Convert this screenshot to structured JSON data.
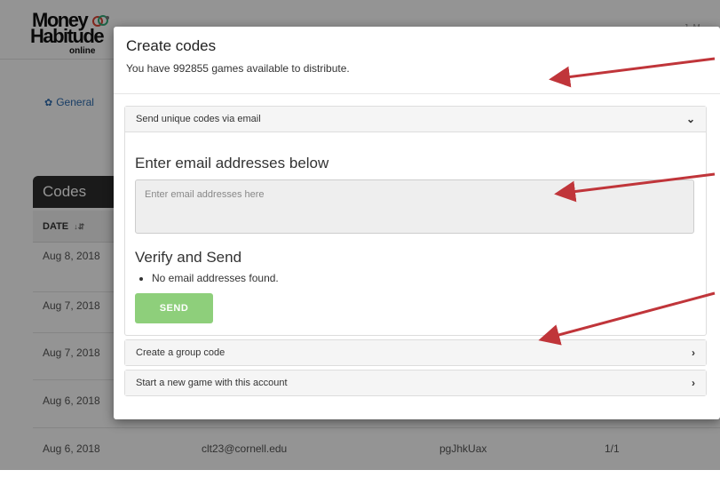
{
  "header": {
    "logo_line1": "Money",
    "logo_line2": "Habitude",
    "logo_sub": "online",
    "user_initials": "J. M"
  },
  "nav": {
    "general_label": "General",
    "general_icon": "gear-icon"
  },
  "codes_table": {
    "title": "Codes",
    "date_header": "DATE",
    "rows": [
      {
        "date": "Aug 8, 2018",
        "email": "",
        "code": "",
        "uses": ""
      },
      {
        "date": "Aug 7, 2018",
        "email": "",
        "code": "",
        "uses": ""
      },
      {
        "date": "Aug 7, 2018",
        "email": "",
        "code": "",
        "uses": ""
      },
      {
        "date": "Aug 6, 2018",
        "email": "",
        "code": "",
        "uses": ""
      },
      {
        "date": "Aug 6, 2018",
        "email": "clt23@cornell.edu",
        "code": "pgJhkUax",
        "uses": "1/1"
      }
    ]
  },
  "modal": {
    "title": "Create codes",
    "subtitle": "You have 992855 games available to distribute.",
    "email_section": {
      "heading": "Send unique codes via email",
      "enter_title": "Enter email addresses below",
      "textarea_placeholder": "Enter email addresses here",
      "verify_title": "Verify and Send",
      "verify_items": [
        "No email addresses found."
      ],
      "send_label": "SEND"
    },
    "group_code_heading": "Create a group code",
    "new_game_heading": "Start a new game with this account"
  },
  "colors": {
    "send_button": "#8ecf7b",
    "annotation_arrow": "#c0353a",
    "link": "#2b6bb0",
    "table_header": "#2d2d2d"
  }
}
